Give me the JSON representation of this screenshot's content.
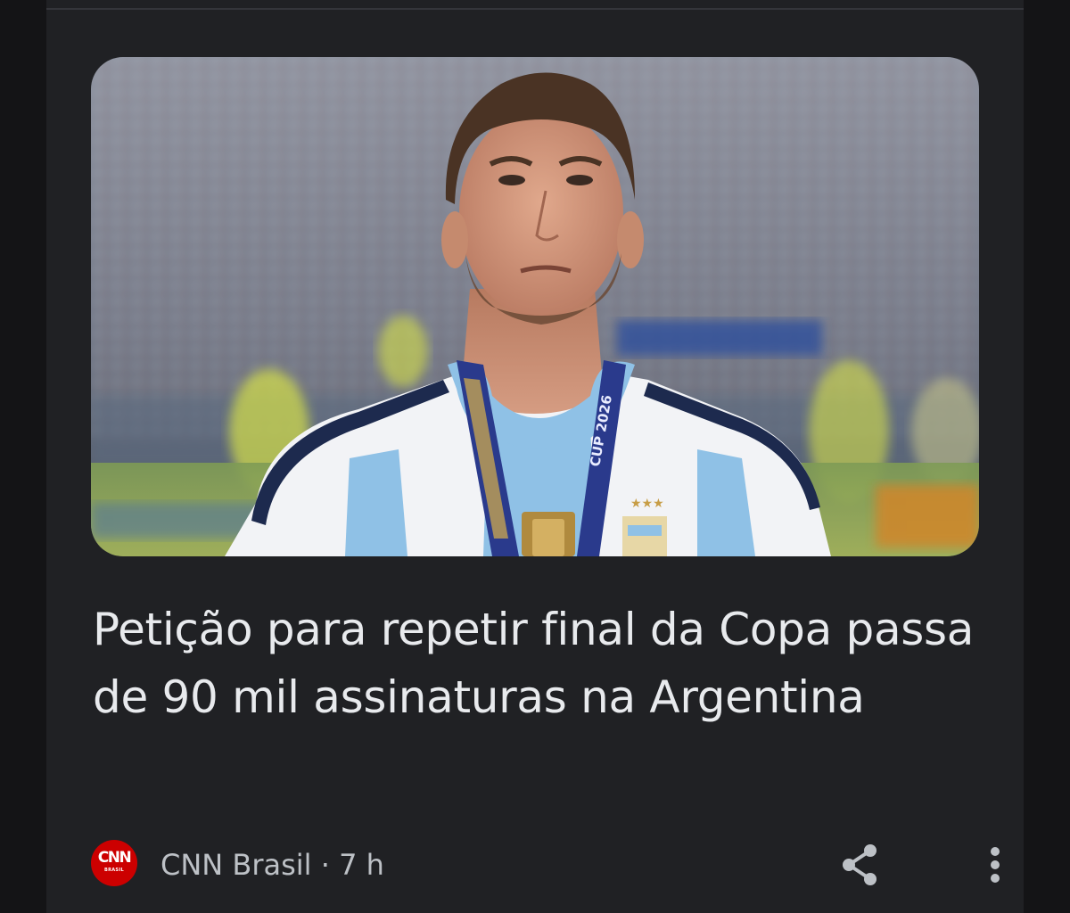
{
  "article": {
    "image_alt": "Argentine footballer in national team jersey wearing a medal in a stadium",
    "headline": "Petição para repetir final da Copa passa de 90 mil assinaturas na Argentina"
  },
  "source": {
    "logo_text": "CNN",
    "logo_subtext": "BRASIL",
    "name": "CNN Brasil",
    "separator": "·",
    "age": "7 h"
  },
  "actions": {
    "share_icon": "share-icon",
    "more_icon": "more-vert-icon"
  },
  "colors": {
    "background": "#141416",
    "card": "#202124",
    "headline_text": "#e8eaed",
    "meta_text": "#bdc1c6",
    "brand_red": "#cc0000"
  }
}
